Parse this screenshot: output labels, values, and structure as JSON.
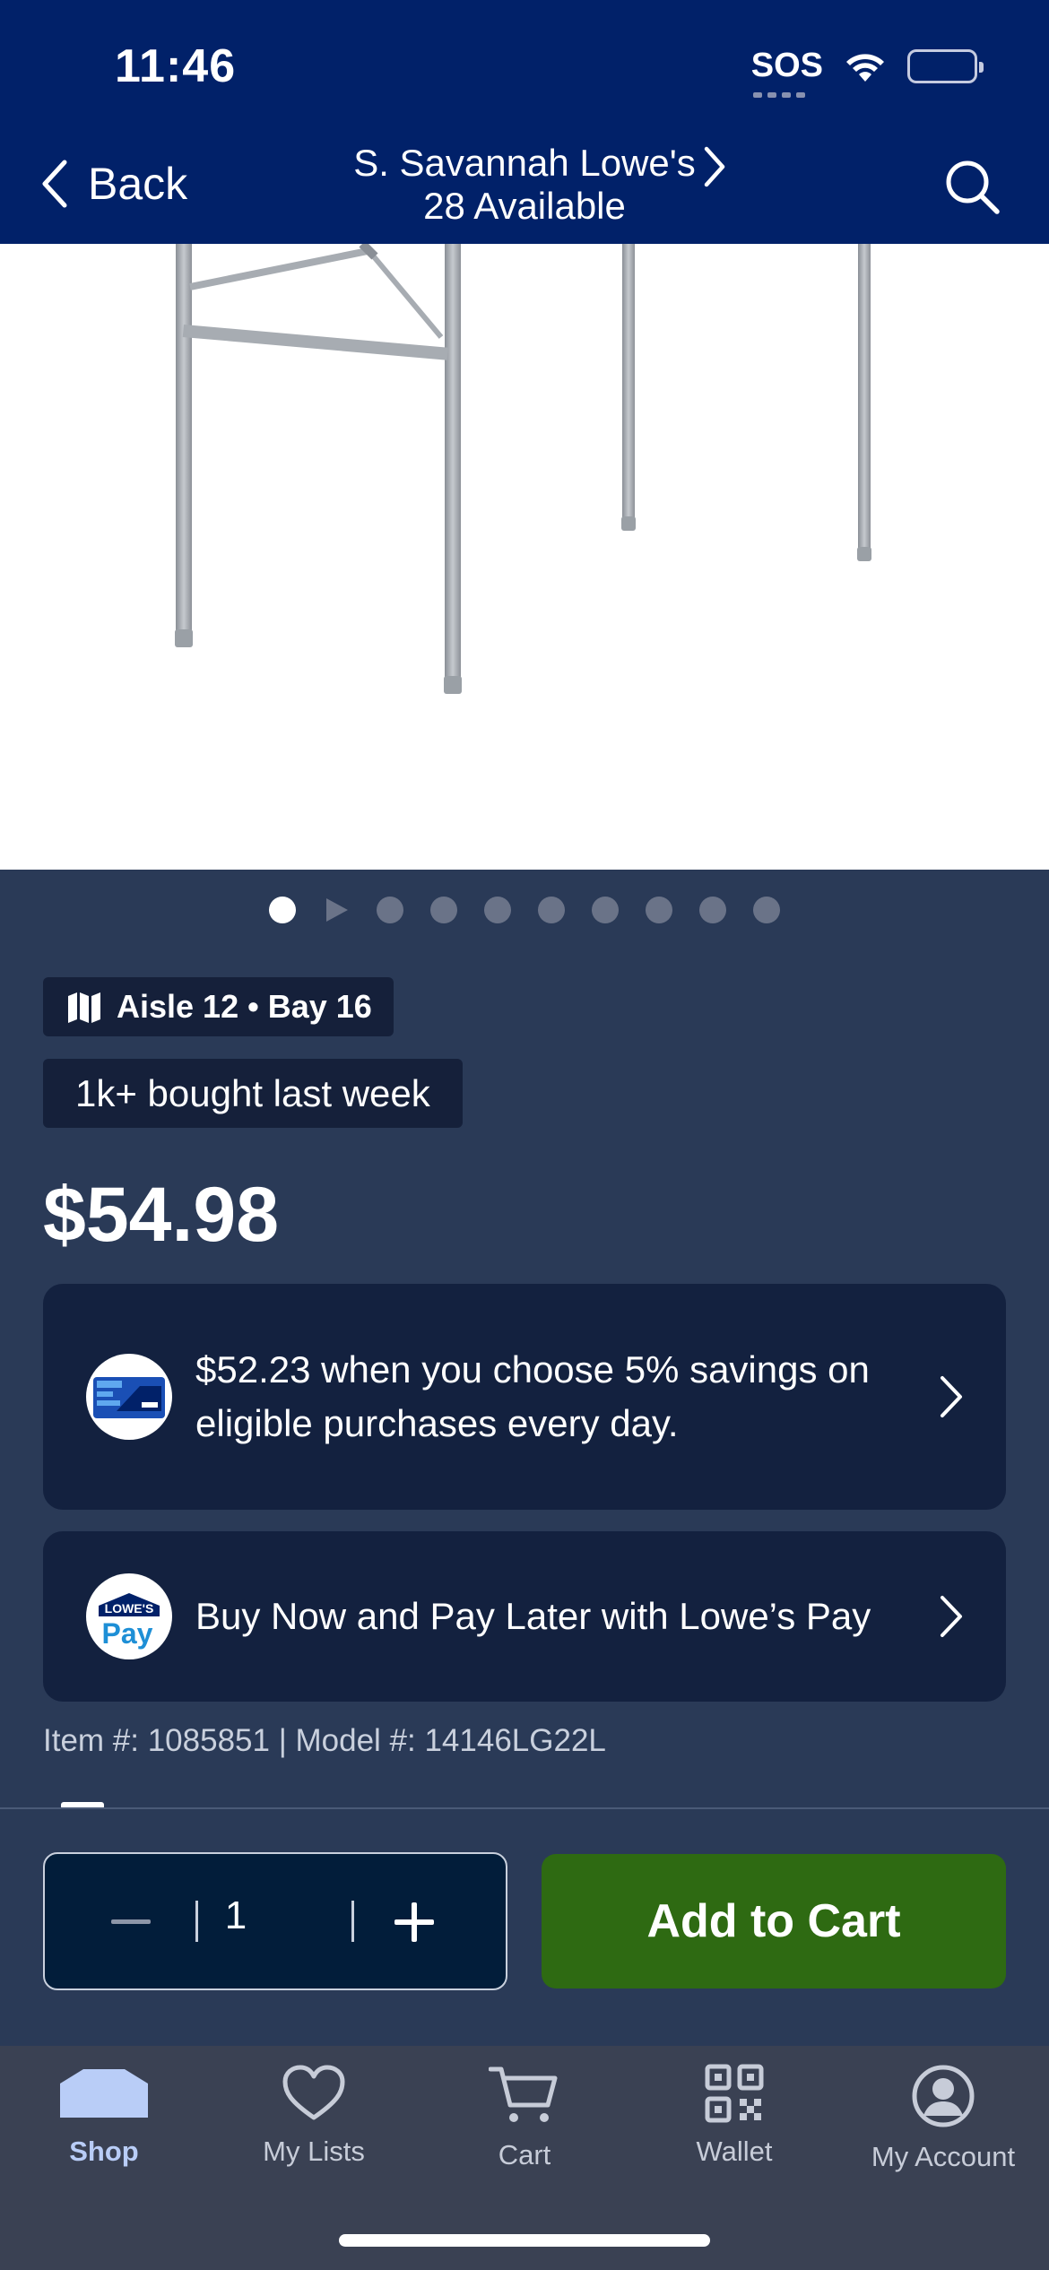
{
  "status_bar": {
    "time": "11:46",
    "sos": "SOS"
  },
  "header": {
    "back_label": "Back",
    "store_name": "S. Savannah Lowe's",
    "availability": "28 Available"
  },
  "carousel": {
    "total_items": 10,
    "active_index": 0
  },
  "product": {
    "aisle_bay": "Aisle 12 • Bay 16",
    "bought_badge": "1k+ bought last week",
    "price": "$54.98",
    "item_model": "Item #: 1085851 | Model #: 14146LG22L"
  },
  "promos": [
    {
      "text": "$52.23 when you choose 5% savings on eligible purchases every day.",
      "icon": "lowes-card-icon"
    },
    {
      "text": "Buy Now and Pay Later with Lowe’s Pay",
      "icon": "lowes-pay-icon"
    }
  ],
  "pay_logo": {
    "top": "LOWE'S",
    "bottom": "Pay"
  },
  "cart": {
    "quantity": "1",
    "add_label": "Add to Cart"
  },
  "tabs": [
    {
      "label": "Shop",
      "icon": "house-icon",
      "active": true
    },
    {
      "label": "My Lists",
      "icon": "heart-icon",
      "active": false
    },
    {
      "label": "Cart",
      "icon": "cart-icon",
      "active": false
    },
    {
      "label": "Wallet",
      "icon": "qr-code-icon",
      "active": false
    },
    {
      "label": "My Account",
      "icon": "account-icon",
      "active": false
    }
  ],
  "colors": {
    "header_bg": "#012169",
    "page_bg": "#2a3a57",
    "card_bg": "#13213f",
    "add_to_cart": "#2e6a12",
    "tab_active": "#b9cdf7"
  }
}
